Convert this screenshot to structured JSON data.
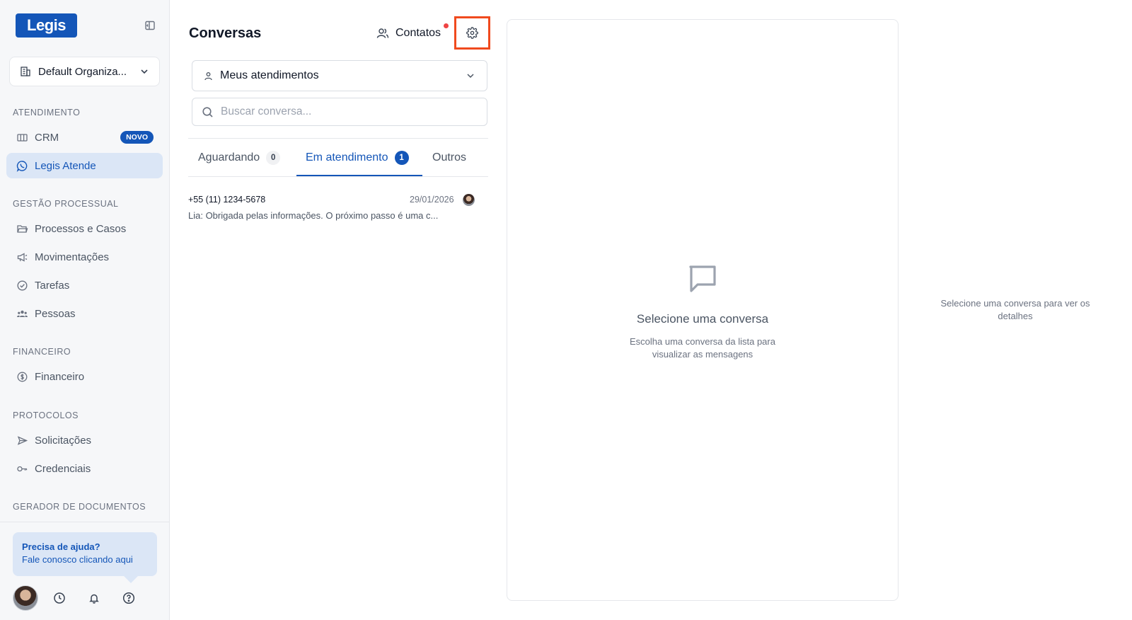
{
  "app": {
    "logo": "Legis"
  },
  "sidebar": {
    "org_name": "Default Organiza...",
    "sections": {
      "atendimento": "ATENDIMENTO",
      "gestao": "GESTÃO PROCESSUAL",
      "financeiro": "FINANCEIRO",
      "protocolos": "PROTOCOLOS",
      "gerador": "GERADOR DE DOCUMENTOS"
    },
    "items": {
      "crm": "CRM",
      "crm_badge": "NOVO",
      "legis_atende": "Legis Atende",
      "processos": "Processos e Casos",
      "movimentacoes": "Movimentações",
      "tarefas": "Tarefas",
      "pessoas": "Pessoas",
      "financeiro": "Financeiro",
      "solicitacoes": "Solicitações",
      "credenciais": "Credenciais"
    },
    "help": {
      "title": "Precisa de ajuda?",
      "subtitle": "Fale conosco clicando aqui"
    }
  },
  "conversations": {
    "title": "Conversas",
    "contacts_label": "Contatos",
    "filter_value": "Meus atendimentos",
    "search_placeholder": "Buscar conversa...",
    "tabs": [
      {
        "label": "Aguardando",
        "count": "0"
      },
      {
        "label": "Em atendimento",
        "count": "1"
      },
      {
        "label": "Outros"
      }
    ],
    "items": [
      {
        "phone": "+55 (11) 1234-5678",
        "date": "29/01/2026",
        "preview": "Lia: Obrigada pelas informações. O próximo passo é uma c..."
      }
    ]
  },
  "messages": {
    "empty_title": "Selecione uma conversa",
    "empty_sub_line1": "Escolha uma conversa da lista para",
    "empty_sub_line2": "visualizar as mensagens"
  },
  "details": {
    "line1": "Selecione uma conversa para ver os",
    "line2": "detalhes"
  },
  "colors": {
    "accent": "#1456b8",
    "highlight": "#f04a1e",
    "notification": "#ef4444"
  }
}
